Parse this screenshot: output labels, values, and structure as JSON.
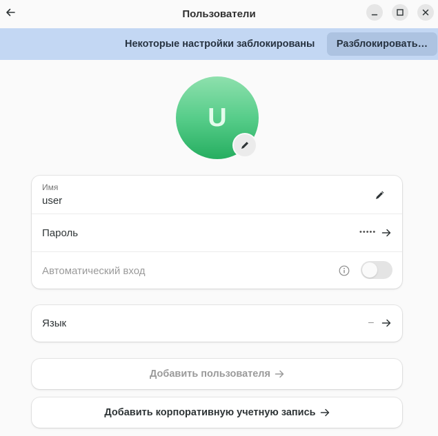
{
  "window": {
    "title": "Пользователи"
  },
  "banner": {
    "text": "Некоторые настройки заблокированы",
    "unlock_label": "Разблокировать…",
    "color": "#c3d7f3"
  },
  "avatar": {
    "initial": "U",
    "color": "#57cd8a"
  },
  "account": {
    "name_label": "Имя",
    "name_value": "user",
    "password_label": "Пароль",
    "password_mask": "•••••",
    "autologin_label": "Автоматический вход",
    "autologin_enabled": false
  },
  "language": {
    "label": "Язык",
    "value": "–"
  },
  "actions": {
    "add_user_label": "Добавить пользователя",
    "add_enterprise_label": "Добавить корпоративную учетную запись"
  },
  "icons": {
    "back": "back-arrow-icon",
    "minimize": "minimize-icon",
    "maximize": "maximize-icon",
    "close": "close-icon",
    "edit": "pencil-icon",
    "next": "arrow-right-icon",
    "info": "info-icon"
  }
}
